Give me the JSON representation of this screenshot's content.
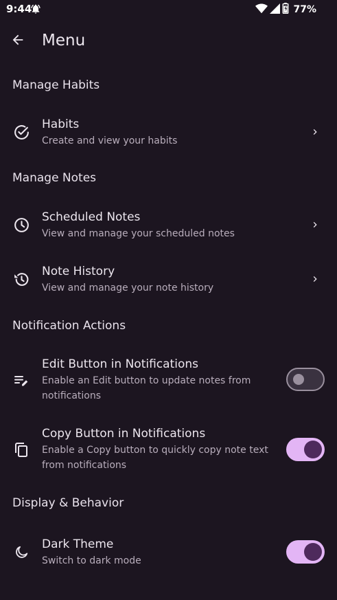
{
  "status_bar": {
    "time": "9:44",
    "battery": "77%"
  },
  "app_bar": {
    "title": "Menu"
  },
  "sections": {
    "habits": {
      "header": "Manage Habits",
      "items": [
        {
          "title": "Habits",
          "subtitle": "Create and view your habits"
        }
      ]
    },
    "notes": {
      "header": "Manage Notes",
      "items": [
        {
          "title": "Scheduled Notes",
          "subtitle": "View and manage your scheduled notes"
        },
        {
          "title": "Note History",
          "subtitle": "View and manage your note history"
        }
      ]
    },
    "notification_actions": {
      "header": "Notification Actions",
      "items": [
        {
          "title": "Edit Button in Notifications",
          "subtitle": "Enable an Edit button to update notes from notifications",
          "enabled": false
        },
        {
          "title": "Copy Button in Notifications",
          "subtitle": "Enable a Copy button to quickly copy note text from notifications",
          "enabled": true
        }
      ]
    },
    "display": {
      "header": "Display & Behavior",
      "items": [
        {
          "title": "Dark Theme",
          "subtitle": "Switch to dark mode",
          "enabled": true
        }
      ]
    }
  },
  "icons": {
    "back": "arrow-back-icon",
    "habits": "check-circle-icon",
    "scheduled_notes": "clock-icon",
    "note_history": "history-icon",
    "edit_button": "edit-note-icon",
    "copy_button": "copy-icon",
    "dark_theme": "moon-icon",
    "chevron": "chevron-right-icon"
  },
  "colors": {
    "background": "#1c1520",
    "toggle_on_track": "#e3b5f5",
    "toggle_on_knob": "#4e2a5c",
    "toggle_off_track": "#3a3240",
    "toggle_off_outline": "#9a909e"
  }
}
